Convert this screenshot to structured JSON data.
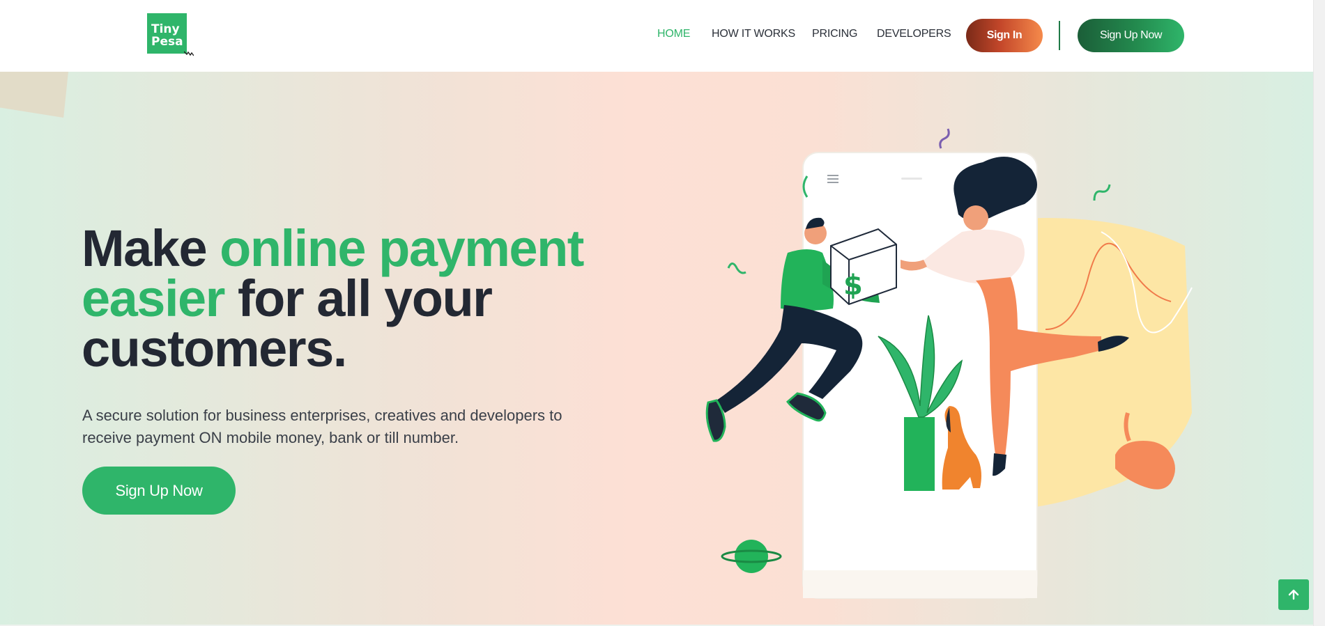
{
  "brand": {
    "logo_line1": "Tiny",
    "logo_line2": "Pesa",
    "accent": "#2fb56a"
  },
  "nav": {
    "items": [
      {
        "label": "HOME",
        "active": true
      },
      {
        "label": "HOW IT WORKS",
        "active": false
      },
      {
        "label": "PRICING",
        "active": false
      },
      {
        "label": "DEVELOPERS",
        "active": false
      }
    ],
    "signin_label": "Sign In",
    "signup_label": "Sign Up Now"
  },
  "hero": {
    "headline_part1": "Make ",
    "headline_green1": "online payment",
    "headline_green2": "easier",
    "headline_part2": " for all your",
    "headline_part3": "customers.",
    "subtext_line1": "A secure solution for business enterprises, creatives and developers to",
    "subtext_line2": "receive payment ON mobile money, bank or till number.",
    "cta_label": "Sign Up Now",
    "dollar_symbol": "$"
  },
  "icons": {
    "to_top": "arrow-up-icon",
    "menu": "hamburger-icon"
  }
}
